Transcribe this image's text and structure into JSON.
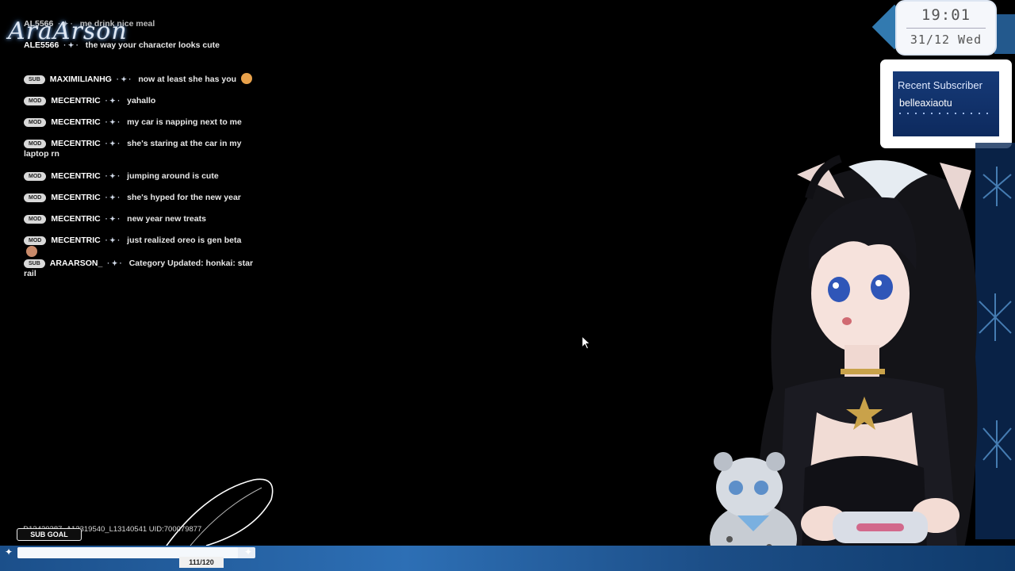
{
  "logo": {
    "text": "AraArson"
  },
  "clock": {
    "time": "19:01",
    "date": "31/12  Wed"
  },
  "recent_subscriber": {
    "title": "Recent Subscriber",
    "name": "belleaxiaotu"
  },
  "chat": {
    "messages": [
      {
        "badge": "",
        "user": "AL5566",
        "text": "me drink nice meal"
      },
      {
        "badge": "",
        "user": "ALE5566",
        "text": "the way your character looks cute"
      },
      {
        "badge": "SUB",
        "user": "MAXIMILIANHG",
        "text": "now at least she has you",
        "emote": "cat-emote"
      },
      {
        "badge": "MOD",
        "user": "MECENTRIC",
        "text": "yahallo"
      },
      {
        "badge": "MOD",
        "user": "MECENTRIC",
        "text": "my car is napping next to me"
      },
      {
        "badge": "MOD",
        "user": "MECENTRIC",
        "text": "she's staring at the car in my laptop rn"
      },
      {
        "badge": "MOD",
        "user": "MECENTRIC",
        "text": "jumping around is cute"
      },
      {
        "badge": "MOD",
        "user": "MECENTRIC",
        "text": "she's hyped for the new year"
      },
      {
        "badge": "MOD",
        "user": "MECENTRIC",
        "text": "new year new treats"
      },
      {
        "badge": "MOD",
        "user": "MECENTRIC",
        "text": "just realized oreo is gen beta",
        "emote": "face-emote"
      },
      {
        "badge": "SUB",
        "user": "ARAARSON_",
        "text": "Category Updated: honkai: star rail"
      }
    ]
  },
  "uid_text": "_D13420287_A13319540_L13140541 UID:700079877",
  "sub_goal": {
    "label": "SUB GOAL",
    "count": "111/120",
    "progress": 0.925
  },
  "colors": {
    "accent": "#2d6fb5",
    "stamp_bg": "#163a78"
  }
}
